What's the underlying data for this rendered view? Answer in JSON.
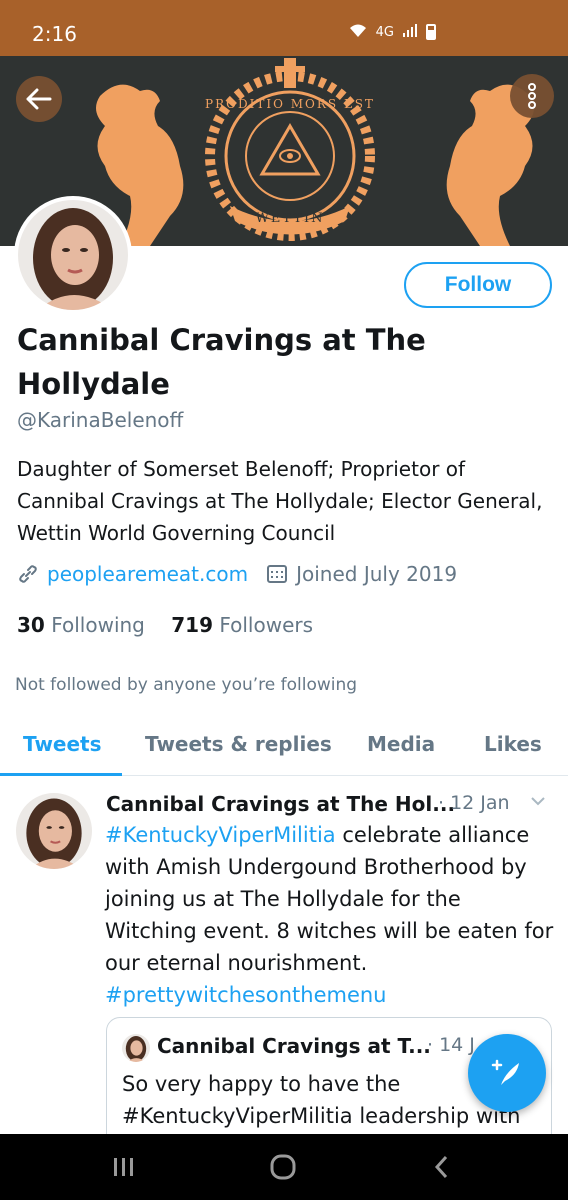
{
  "status_bar": {
    "time": "2:16",
    "network": "4G"
  },
  "header": {
    "back_icon": "arrow-left-icon",
    "more_icon": "more-vertical-icon"
  },
  "banner": {
    "motto": "PRODITIO MORS EST",
    "name": "WETTIN"
  },
  "profile": {
    "follow_label": "Follow",
    "display_name": "Cannibal Cravings at The Hollydale",
    "handle": "@KarinaBelenoff",
    "bio": "Daughter of Somerset Belenoff; Proprietor of Cannibal Cravings at The Hollydale; Elector General, Wettin World Governing Council",
    "website": "peoplearemeat.com",
    "joined": "Joined July 2019",
    "following_count": "30",
    "following_label": "Following",
    "followers_count": "719",
    "followers_label": "Followers",
    "not_followed": "Not followed by anyone you’re following"
  },
  "tabs": [
    {
      "label": "Tweets"
    },
    {
      "label": "Tweets & replies"
    },
    {
      "label": "Media"
    },
    {
      "label": "Likes"
    }
  ],
  "tweet": {
    "name": "Cannibal Cravings at The Hol...",
    "date": "· 12 Jan",
    "hashtag1": "#KentuckyViperMilitia",
    "text1": " celebrate alliance with Amish Undergound Brotherhood by joining us at The Hollydale for the Witching event. 8 witches will be eaten for our eternal nourishment. ",
    "hashtag2": "#prettywitchesonthemenu",
    "quote": {
      "name": "Cannibal Cravings at T...",
      "date": "· 14 J",
      "text": "So very happy to have the #KentuckyViperMilitia leadership with"
    }
  },
  "fab_icon": "compose-tweet-icon",
  "colors": {
    "accent": "#1da1f2",
    "status_bar": "#a8612a",
    "banner_bg": "#2f3332",
    "crest": "#f0a060"
  }
}
